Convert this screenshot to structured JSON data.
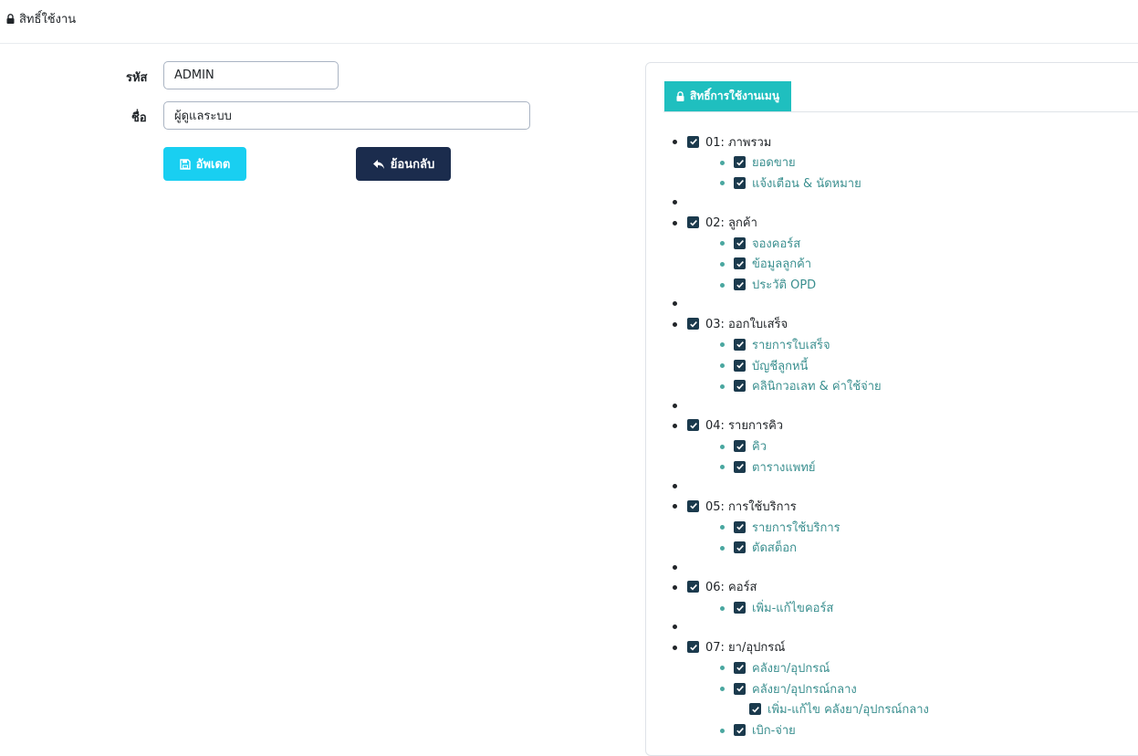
{
  "header": {
    "title": "สิทธิ์ใช้งาน",
    "icon": "lock-icon"
  },
  "form": {
    "code_label": "รหัส",
    "code_value": "ADMIN",
    "name_label": "ชื่อ",
    "name_value": "ผู้ดูแลระบบ",
    "update_label": "อัพเดต",
    "back_label": "ย้อนกลับ"
  },
  "panel": {
    "tab_label": "สิทธิ์การใช้งานเมนู",
    "groups": [
      {
        "label": "01: ภาพรวม",
        "checked": true,
        "items": [
          {
            "label": "ยอดขาย",
            "checked": true
          },
          {
            "label": "แจ้งเตือน & นัดหมาย",
            "checked": true
          }
        ]
      },
      {
        "label": "02: ลูกค้า",
        "checked": true,
        "items": [
          {
            "label": "จองคอร์ส",
            "checked": true
          },
          {
            "label": "ข้อมูลลูกค้า",
            "checked": true
          },
          {
            "label": "ประวัติ OPD",
            "checked": true
          }
        ]
      },
      {
        "label": "03: ออกใบเสร็จ",
        "checked": true,
        "items": [
          {
            "label": "รายการใบเสร็จ",
            "checked": true
          },
          {
            "label": "บัญชีลูกหนี้",
            "checked": true
          },
          {
            "label": "คลินิกวอเลท & ค่าใช้จ่าย",
            "checked": true
          }
        ]
      },
      {
        "label": "04: รายการคิว",
        "checked": true,
        "items": [
          {
            "label": "คิว",
            "checked": true
          },
          {
            "label": "ตารางแพทย์",
            "checked": true
          }
        ]
      },
      {
        "label": "05: การใช้บริการ",
        "checked": true,
        "items": [
          {
            "label": "รายการใช้บริการ",
            "checked": true
          },
          {
            "label": "ตัดสต็อก",
            "checked": true
          }
        ]
      },
      {
        "label": "06: คอร์ส",
        "checked": true,
        "items": [
          {
            "label": "เพิ่ม-แก้ไขคอร์ส",
            "checked": true
          }
        ]
      },
      {
        "label": "07: ยา/อุปกรณ์",
        "checked": true,
        "items": [
          {
            "label": "คลังยา/อุปกรณ์",
            "checked": true
          },
          {
            "label": "คลังยา/อุปกรณ์กลาง",
            "checked": true,
            "children": [
              {
                "label": "เพิ่ม-แก้ไข คลังยา/อุปกรณ์กลาง",
                "checked": true
              }
            ]
          },
          {
            "label": "เบิก-จ่าย",
            "checked": true
          }
        ]
      }
    ]
  },
  "colors": {
    "update_button": "#19cff1",
    "back_button": "#1b2c4d",
    "tab": "#1fbfbf",
    "checkbox": "#1b3a4d",
    "sub_label": "#3a8f8f"
  }
}
